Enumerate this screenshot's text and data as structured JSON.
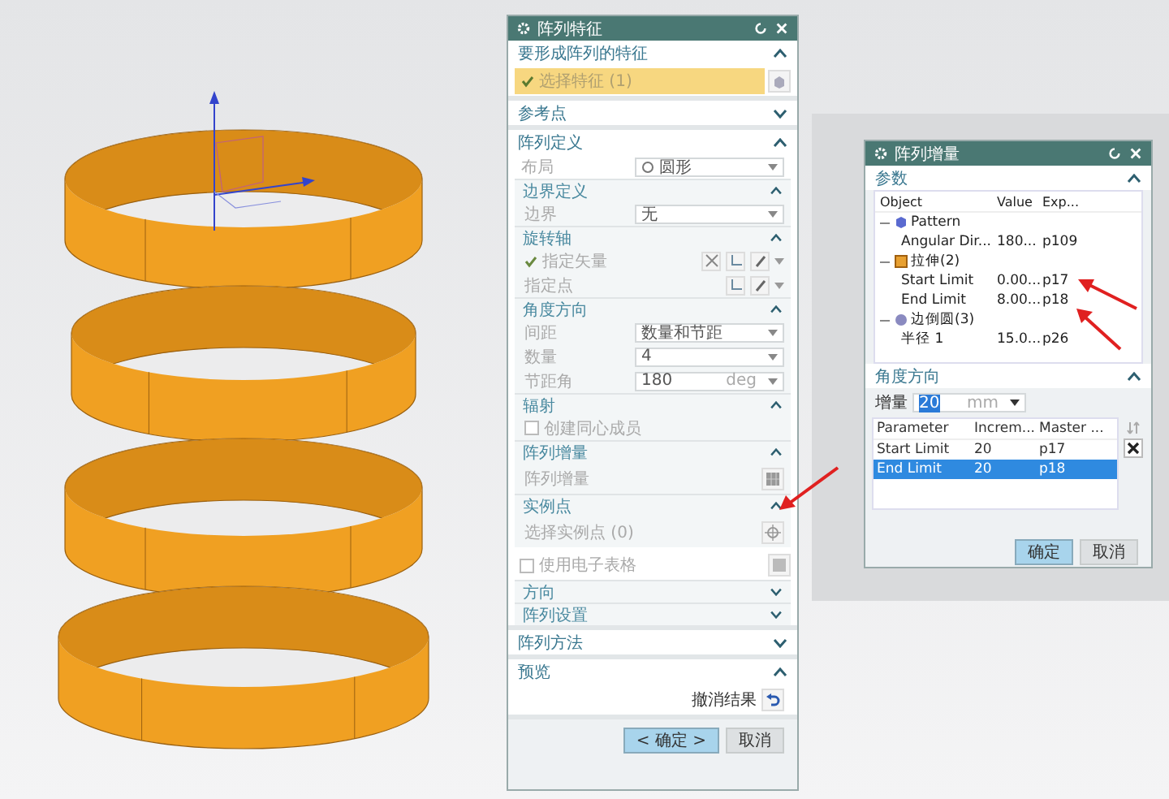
{
  "main_dialog": {
    "title": "阵列特征",
    "sections": [
      {
        "title": "要形成阵列的特征",
        "expanded": true,
        "rows": [
          {
            "kind": "select",
            "checked": true,
            "label": "选择特征 (1)"
          }
        ]
      },
      {
        "title": "参考点",
        "expanded": false
      },
      {
        "title": "阵列定义",
        "expanded": true,
        "rows": [
          {
            "kind": "layout",
            "label": "布局",
            "value": "圆形"
          },
          {
            "kind": "group",
            "title": "边界定义",
            "expanded": true,
            "rows": [
              {
                "kind": "dropdown",
                "label": "边界",
                "value": "无"
              }
            ]
          },
          {
            "kind": "group",
            "title": "旋转轴",
            "expanded": true,
            "rows": [
              {
                "kind": "vector",
                "label": "指定矢量",
                "checked": true
              },
              {
                "kind": "point",
                "label": "指定点",
                "checked": false
              }
            ]
          },
          {
            "kind": "group",
            "title": "角度方向",
            "expanded": true,
            "rows": [
              {
                "kind": "dropdown",
                "label": "间距",
                "value": "数量和节距"
              },
              {
                "kind": "dropdown",
                "label": "数量",
                "value": "4"
              },
              {
                "kind": "dropdown",
                "label": "节距角",
                "value": "180",
                "unit": "deg"
              }
            ]
          },
          {
            "kind": "group",
            "title": "辐射",
            "expanded": true,
            "rows": [
              {
                "kind": "checkbox",
                "label": "创建同心成员",
                "checked": false
              }
            ]
          },
          {
            "kind": "group",
            "title": "阵列增量",
            "expanded": true,
            "rows": [
              {
                "kind": "action",
                "label": "阵列增量"
              }
            ]
          },
          {
            "kind": "group",
            "title": "实例点",
            "expanded": true,
            "rows": [
              {
                "kind": "instance",
                "label": "选择实例点 (0)"
              }
            ]
          },
          {
            "kind": "sheet",
            "label": "使用电子表格",
            "checked": false
          },
          {
            "kind": "group",
            "title": "方向",
            "expanded": false
          },
          {
            "kind": "group",
            "title": "阵列设置",
            "expanded": false
          }
        ]
      },
      {
        "title": "阵列方法",
        "expanded": false
      },
      {
        "title": "预览",
        "expanded": true,
        "rows": [
          {
            "kind": "undo",
            "label": "撤消结果"
          }
        ]
      }
    ],
    "buttons": [
      {
        "label": "< 确定 >",
        "kind": "primary"
      },
      {
        "label": "取消",
        "kind": "normal"
      }
    ]
  },
  "increment_dialog": {
    "title": "阵列增量",
    "params": {
      "title": "参数",
      "expanded": true,
      "columns": [
        "Object",
        "Value",
        "Exp..."
      ],
      "tree": [
        {
          "label": "Pattern",
          "kind": "pattern",
          "expanded": true,
          "children": [
            {
              "label": "Angular Dir...",
              "value": "180...",
              "exp": "p109"
            }
          ]
        },
        {
          "label": "拉伸(2)",
          "kind": "extrude",
          "expanded": true,
          "children": [
            {
              "label": "Start Limit",
              "value": "0.00...",
              "exp": "p17"
            },
            {
              "label": "End Limit",
              "value": "8.00...",
              "exp": "p18"
            }
          ]
        },
        {
          "label": "边倒圆(3)",
          "kind": "blend",
          "expanded": true,
          "children": [
            {
              "label": "半径 1",
              "value": "15.0...",
              "exp": "p26"
            }
          ]
        }
      ]
    },
    "direction": {
      "title": "角度方向",
      "expanded": true,
      "increment_label": "增量",
      "increment_value": "20",
      "unit": "mm",
      "columns": [
        "Parameter",
        "Increm...",
        "Master ..."
      ],
      "rows": [
        {
          "cells": [
            "Start Limit",
            "20",
            "p17"
          ],
          "selected": false
        },
        {
          "cells": [
            "End Limit",
            "20",
            "p18"
          ],
          "selected": true
        }
      ]
    },
    "buttons": [
      {
        "label": "确定",
        "kind": "primary"
      },
      {
        "label": "取消",
        "kind": "normal"
      }
    ]
  }
}
